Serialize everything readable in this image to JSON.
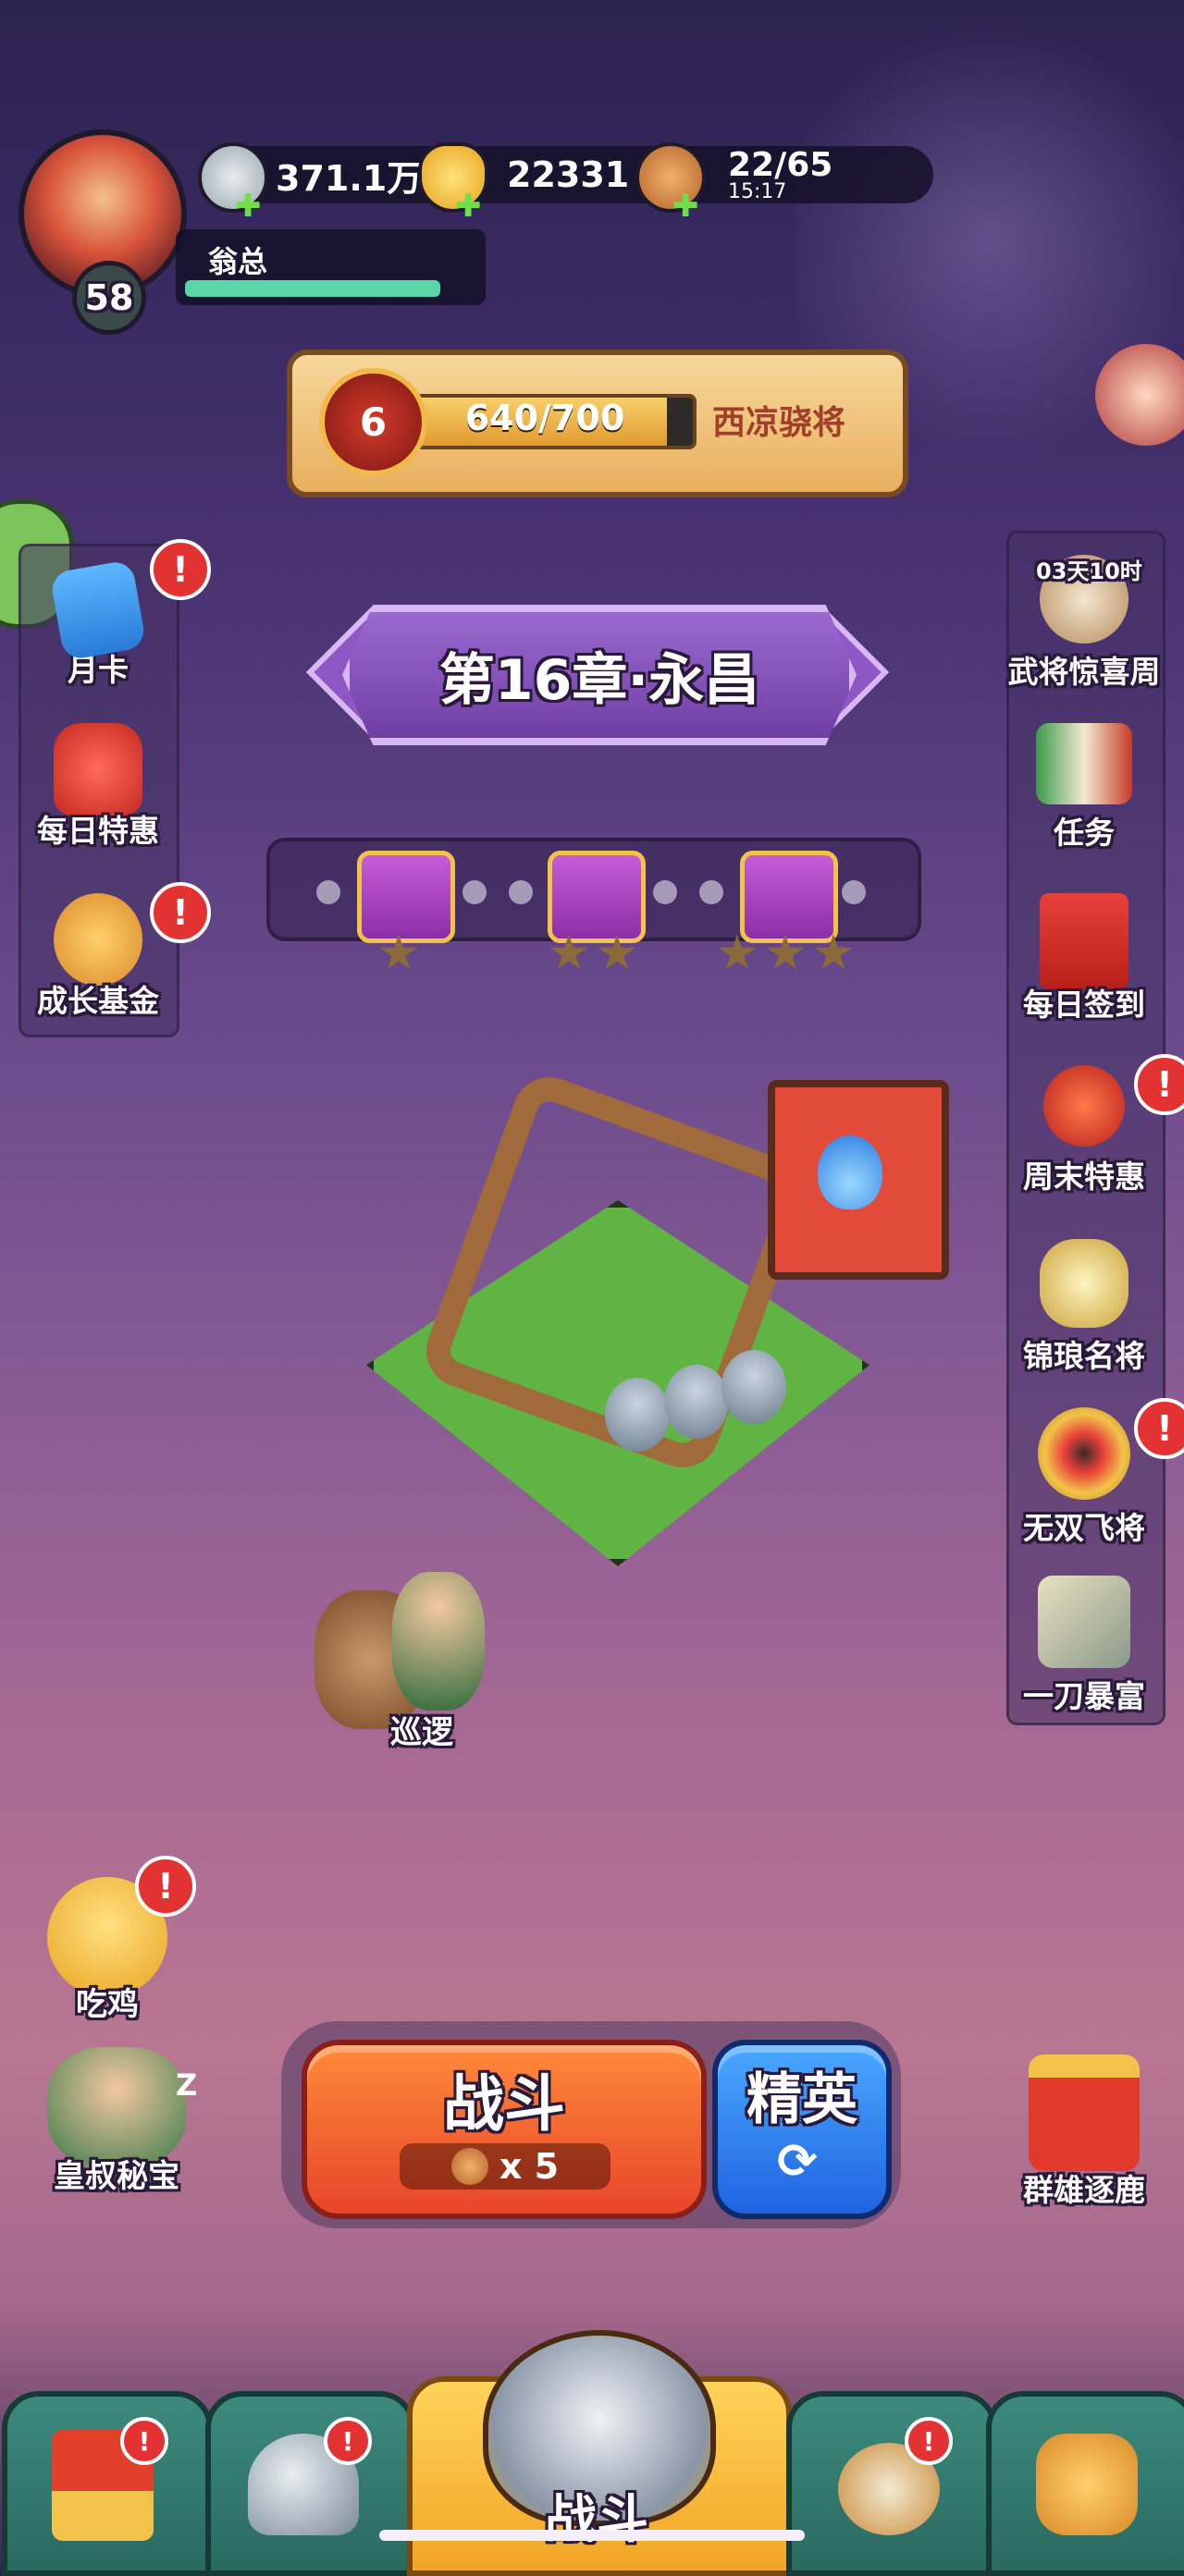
{
  "player": {
    "level": "58",
    "name": "翁总",
    "exp_fraction": 0.92
  },
  "resources": {
    "silver": "371.1万",
    "gold": "22331",
    "stamina": "22/65",
    "stamina_timer": "15:17"
  },
  "rank": {
    "medal_level": "6",
    "progress": "640/700",
    "progress_fraction": 0.914,
    "title": "西凉骁将"
  },
  "chapter": {
    "title": "第16章·永昌"
  },
  "left_menu": [
    {
      "label": "月卡",
      "alert": true
    },
    {
      "label": "每日特惠",
      "alert": false
    },
    {
      "label": "成长基金",
      "alert": true
    }
  ],
  "right_menu": [
    {
      "label": "武将惊喜周",
      "timer": "03天10时",
      "alert": false
    },
    {
      "label": "任务",
      "alert": false
    },
    {
      "label": "每日签到",
      "alert": false
    },
    {
      "label": "周末特惠",
      "alert": true
    },
    {
      "label": "锦琅名将",
      "alert": false
    },
    {
      "label": "无双飞将",
      "alert": true
    },
    {
      "label": "一刀暴富",
      "alert": false
    }
  ],
  "map": {
    "patrol_label": "巡逻"
  },
  "bottom_left": [
    {
      "label": "吃鸡",
      "alert": true
    },
    {
      "label": "皇叔秘宝",
      "sleep": "Z"
    }
  ],
  "bottom_right": {
    "label": "群雄逐鹿"
  },
  "battle": {
    "fight_label": "战斗",
    "cost": "x 5",
    "elite_label": "精英"
  },
  "nav": {
    "center_label": "战斗"
  },
  "icon_names": {
    "silver": "silver-coin-icon",
    "gold": "gold-ingot-icon",
    "stamina": "drumstick-icon",
    "refresh": "refresh-icon",
    "alert": "exclamation-icon",
    "menu": "hamburger-icon"
  }
}
